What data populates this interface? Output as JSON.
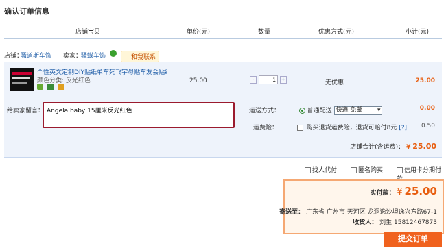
{
  "page_title": "确认订单信息",
  "header": {
    "col_item": "店铺宝贝",
    "col_price": "单价(元)",
    "col_qty": "数量",
    "col_discount": "优惠方式(元)",
    "col_subtotal": "小计(元)"
  },
  "shop": {
    "shop_label": "店铺：",
    "shop_name": "骚道斯车饰",
    "seller_label": "卖家：",
    "seller_name": "骚蝶车饰",
    "contact_label": "和我联系"
  },
  "item": {
    "title": "个性英文定制DIY贴纸单车死飞宇母贴车友会贴纸...",
    "spec": "颜色分类: 反光红色",
    "price": "25.00",
    "quantity": "1",
    "discount": "无优惠",
    "subtotal": "25.00",
    "minus": "-",
    "plus": "+"
  },
  "message": {
    "label": "给卖家留言：",
    "value": "Angela baby  15厘米反光红色"
  },
  "shipping": {
    "label": "运送方式：",
    "option": "普通配送",
    "select_value": "快递 免邮",
    "fee": "0.00"
  },
  "insurance": {
    "label": "运费险：",
    "text": "购买退货运费险，退货可赔付8元",
    "help": "[?]",
    "fee": "0.50"
  },
  "shop_total": {
    "label": "店铺合计(含运费)：",
    "currency": "¥",
    "value": "25.00"
  },
  "options": {
    "proxy_pay": "找人代付",
    "anonymous": "匿名购买",
    "credit": "信用卡分期付款"
  },
  "payment": {
    "actual_label": "实付款：",
    "currency": "¥",
    "actual_value": "25.00",
    "ship_to_label": "寄送至：",
    "address": "广东省 广州市 天河区 龙洞逸沙坦逸兴东路67-1",
    "receiver_label": "收货人：",
    "receiver": "刘生 15812467873"
  },
  "submit_label": "提交订单",
  "colors": {
    "accent_orange": "#f0621e",
    "link_blue": "#1a5aa6",
    "panel_bg": "#eef3fb",
    "highlight_red": "#9b1b2e"
  }
}
